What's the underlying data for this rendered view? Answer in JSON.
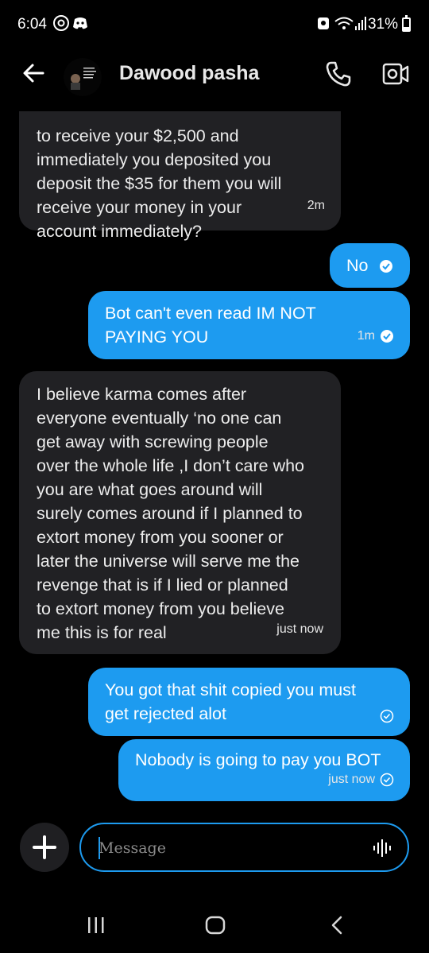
{
  "status": {
    "time": "6:04",
    "battery_text": "31%",
    "battery_level": 0.31,
    "icons": [
      "threads-icon",
      "discord-icon",
      "alarm-icon",
      "wifi-icon",
      "signal-icon",
      "battery-icon"
    ]
  },
  "header": {
    "contact_name": "Dawood pasha",
    "icons": [
      "back-arrow-icon",
      "avatar",
      "phone-icon",
      "video-icon"
    ]
  },
  "messages": [
    {
      "dir": "in",
      "text": "to receive your $2,500 and\nimmediately you deposited you\ndeposit the $35 for them you will\nreceive your money in your\naccount immediately?",
      "time": "2m"
    },
    {
      "dir": "out",
      "text": "No",
      "time": "",
      "status": "read"
    },
    {
      "dir": "out",
      "text": "Bot can't even read IM NOT\nPAYING YOU",
      "time": "1m",
      "status": "read"
    },
    {
      "dir": "in",
      "text": "I believe karma comes after\neveryone eventually ‘no one can\nget away with screwing people\nover the whole life ,I don’t care who\nyou are what goes around will\nsurely comes around if I planned to\nextort money from you sooner or\nlater the universe will serve me the\nrevenge that is if I lied or planned\nto extort money from you believe\nme this is for real",
      "time": "just now"
    },
    {
      "dir": "out",
      "text": "You got that shit copied you must\nget rejected alot",
      "time": "",
      "status": "sent"
    },
    {
      "dir": "out",
      "text": "Nobody is going to pay you BOT",
      "time": "just now",
      "status": "sent"
    }
  ],
  "composer": {
    "placeholder": "Message",
    "icons": [
      "plus-icon",
      "voice-icon"
    ]
  },
  "navbar": {
    "icons": [
      "recent-apps-icon",
      "home-icon",
      "back-nav-icon"
    ]
  },
  "colors": {
    "accent": "#1d9bf0",
    "incoming_bubble": "#212124",
    "background": "#000000"
  }
}
